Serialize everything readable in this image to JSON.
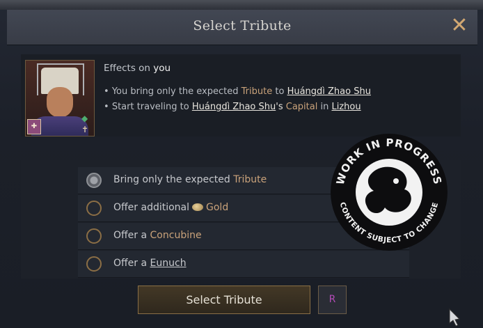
{
  "window": {
    "title": "Select Tribute",
    "close_icon": "close-icon"
  },
  "effects": {
    "heading_prefix": "Effects on",
    "heading_target": "you",
    "line1": {
      "bullet": "•",
      "text_a": "You bring only the expected",
      "tribute": "Tribute",
      "text_b": "to",
      "ruler": "Huángdì Zhao Shu"
    },
    "line2": {
      "bullet": "•",
      "text_a": "Start traveling to",
      "ruler": "Huángdì Zhao Shu",
      "possessive": "'s",
      "capital": "Capital",
      "text_b": "in",
      "place": "Lizhou"
    }
  },
  "options": [
    {
      "prefix": "Bring only the expected",
      "highlight": "Tribute",
      "selected": true
    },
    {
      "prefix": "Offer additional",
      "highlight": "Gold",
      "icon": "gold-icon",
      "selected": false
    },
    {
      "prefix": "Offer a",
      "highlight": "Concubine",
      "selected": false
    },
    {
      "prefix": "Offer a",
      "link": "Eunuch",
      "selected": false
    }
  ],
  "watermark": {
    "top": "WORK IN PROGRESS",
    "bottom": "CONTENT SUBJECT TO CHANGE"
  },
  "actions": {
    "select_label": "Select Tribute",
    "shortcut": "R"
  },
  "colors": {
    "accent_gold": "#c9a27a",
    "close": "#d2a872",
    "shortcut": "#b34bb7"
  }
}
